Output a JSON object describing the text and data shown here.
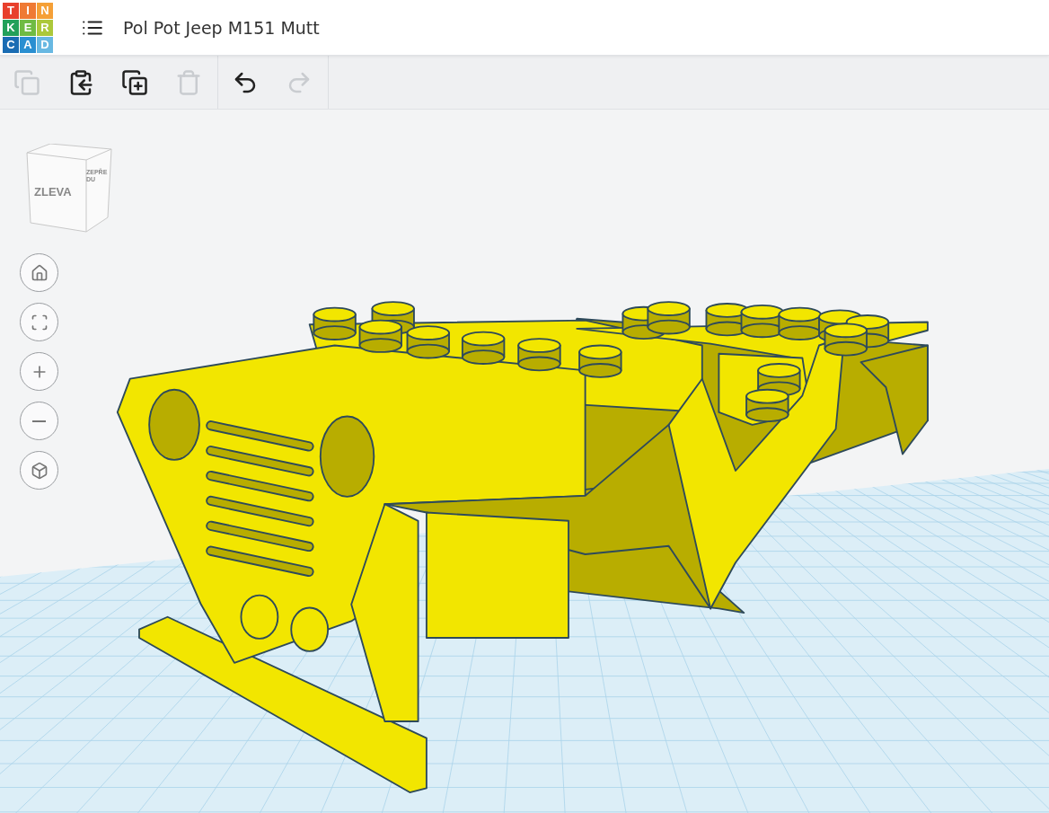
{
  "logo": {
    "letters": [
      {
        "char": "T",
        "color": "#e8402c"
      },
      {
        "char": "I",
        "color": "#ef7a35"
      },
      {
        "char": "N",
        "color": "#f5a037"
      },
      {
        "char": "K",
        "color": "#23a05a"
      },
      {
        "char": "E",
        "color": "#6fbb43"
      },
      {
        "char": "R",
        "color": "#acc83a"
      },
      {
        "char": "C",
        "color": "#1a6cb3"
      },
      {
        "char": "A",
        "color": "#2a8fd1"
      },
      {
        "char": "D",
        "color": "#68b8e2"
      }
    ]
  },
  "header": {
    "title": "Pol Pot Jeep M151 Mutt"
  },
  "toolbar": [
    {
      "kind": "copy",
      "disabled": true
    },
    {
      "kind": "paste",
      "disabled": false
    },
    {
      "kind": "duplicate",
      "disabled": false
    },
    {
      "kind": "delete",
      "disabled": true
    },
    {
      "kind": "undo",
      "disabled": false
    },
    {
      "kind": "redo",
      "disabled": true
    }
  ],
  "view_cube": {
    "left_face": "ZLEVA",
    "front_face": "ZEPŘEDU"
  },
  "nav_buttons": [
    {
      "kind": "home"
    },
    {
      "kind": "fit"
    },
    {
      "kind": "zoom_in"
    },
    {
      "kind": "zoom_out"
    },
    {
      "kind": "ortho"
    }
  ]
}
